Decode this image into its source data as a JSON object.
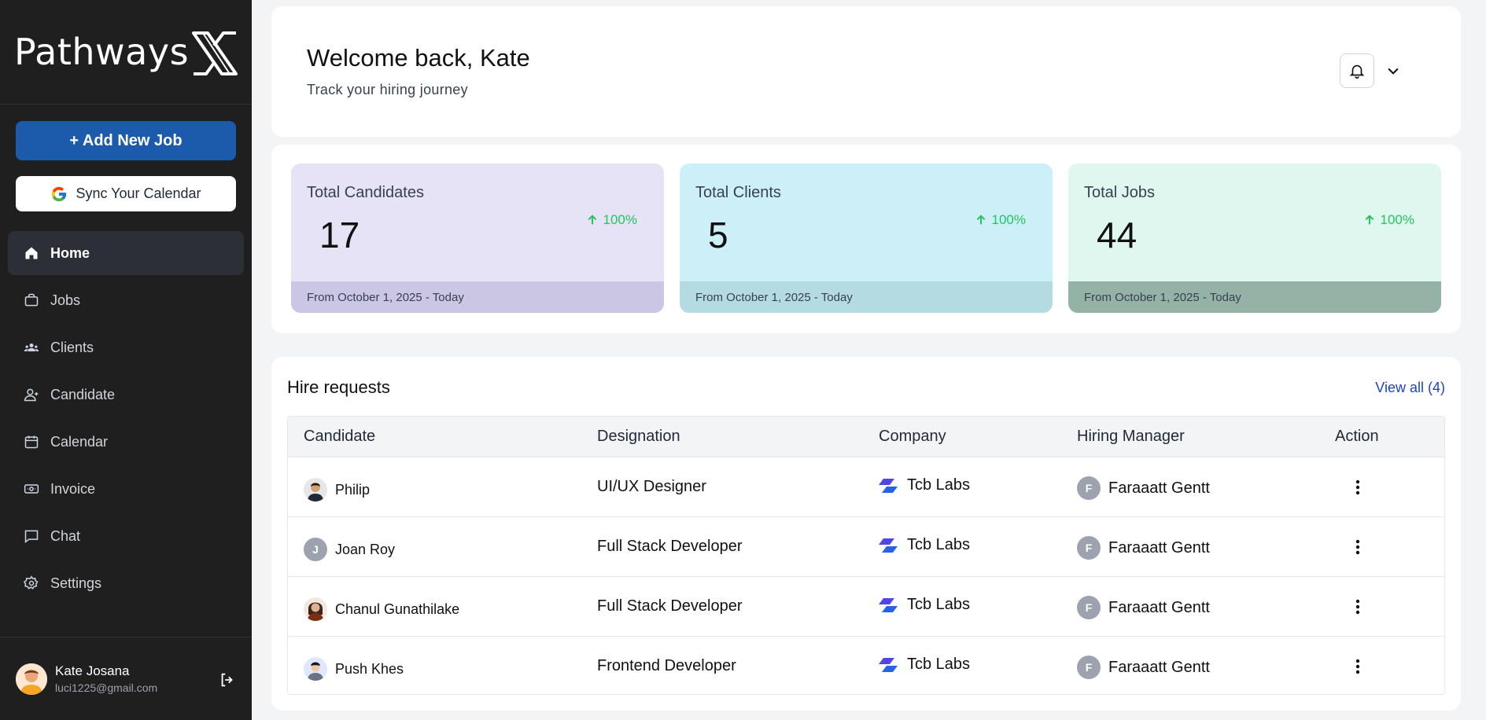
{
  "brand": {
    "name": "Pathways"
  },
  "sidebar": {
    "add_job_label": "+ Add New Job",
    "sync_calendar_label": "Sync Your Calendar",
    "items": [
      {
        "label": "Home",
        "icon": "home-icon",
        "active": true
      },
      {
        "label": "Jobs",
        "icon": "briefcase-icon"
      },
      {
        "label": "Clients",
        "icon": "users-icon"
      },
      {
        "label": "Candidate",
        "icon": "user-icon"
      },
      {
        "label": "Calendar",
        "icon": "calendar-icon"
      },
      {
        "label": "Invoice",
        "icon": "invoice-icon"
      },
      {
        "label": "Chat",
        "icon": "chat-icon"
      },
      {
        "label": "Settings",
        "icon": "gear-icon"
      }
    ],
    "user": {
      "name": "Kate Josana",
      "email": "luci1225@gmail.com"
    }
  },
  "header": {
    "title": "Welcome back, Kate",
    "subtitle": "Track your hiring journey"
  },
  "stats": [
    {
      "label": "Total Candidates",
      "value": "17",
      "change": "100%",
      "footer": "From October 1, 2025 - Today",
      "bg": "#e5e3f5",
      "footer_bg": "#cbc6e3"
    },
    {
      "label": "Total Clients",
      "value": "5",
      "change": "100%",
      "footer": "From October 1, 2025 - Today",
      "bg": "#cdf0f8",
      "footer_bg": "#b4dbe2"
    },
    {
      "label": "Total Jobs",
      "value": "44",
      "change": "100%",
      "footer": "From October 1, 2025 - Today",
      "bg": "#dff7ee",
      "footer_bg": "#94b2a6"
    }
  ],
  "hire_requests": {
    "title": "Hire requests",
    "view_all": "View all (4)",
    "columns": [
      "Candidate",
      "Designation",
      "Company",
      "Hiring Manager",
      "Action"
    ],
    "rows": [
      {
        "candidate": "Philip",
        "avatar": "photo",
        "designation": "UI/UX Designer",
        "company": "Tcb Labs",
        "manager": "Faraaatt Gentt",
        "manager_initial": "F"
      },
      {
        "candidate": "Joan Roy",
        "avatar": "J",
        "designation": "Full Stack Developer",
        "company": "Tcb Labs",
        "manager": "Faraaatt Gentt",
        "manager_initial": "F"
      },
      {
        "candidate": "Chanul Gunathilake",
        "avatar": "photo",
        "designation": "Full Stack Developer",
        "company": "Tcb Labs",
        "manager": "Faraaatt Gentt",
        "manager_initial": "F"
      },
      {
        "candidate": "Push Khes",
        "avatar": "photo",
        "designation": "Frontend Developer",
        "company": "Tcb Labs",
        "manager": "Faraaatt Gentt",
        "manager_initial": "F"
      }
    ]
  },
  "colors": {
    "primary": "#1c5bab",
    "sidebar_bg": "#1f1f1f",
    "positive": "#22c55e",
    "link": "#1e3fd8"
  }
}
